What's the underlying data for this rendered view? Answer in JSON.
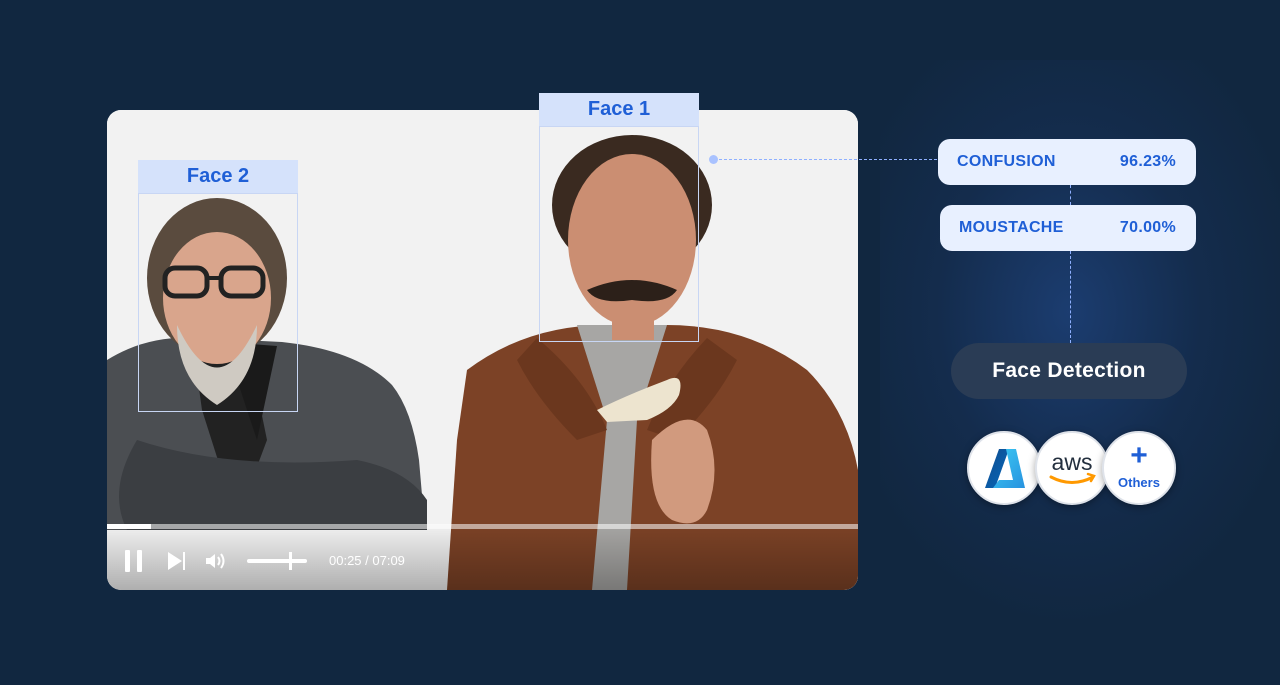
{
  "faces": [
    {
      "label": "Face 1"
    },
    {
      "label": "Face 2"
    }
  ],
  "attributes": [
    {
      "name": "CONFUSION",
      "value": "96.23%"
    },
    {
      "name": "MOUSTACHE",
      "value": "70.00%"
    }
  ],
  "feature_button": {
    "label": "Face Detection"
  },
  "providers": [
    {
      "name": "Microsoft Azure",
      "icon": "azure-logo-icon"
    },
    {
      "name": "aws",
      "label": "aws",
      "icon": "aws-logo-icon"
    },
    {
      "name": "Others",
      "label": "Others",
      "icon": "plus-icon"
    }
  ],
  "player": {
    "time": "00:25 / 07:09",
    "progress": 0.058,
    "volume": 0.72,
    "state": "playing"
  },
  "colors": {
    "background": "#112740",
    "accent": "#1f5fd6",
    "pill_bg": "#e8f0ff",
    "face_label_bg": "#d5e2fb",
    "button_bg": "#2a3c55"
  }
}
